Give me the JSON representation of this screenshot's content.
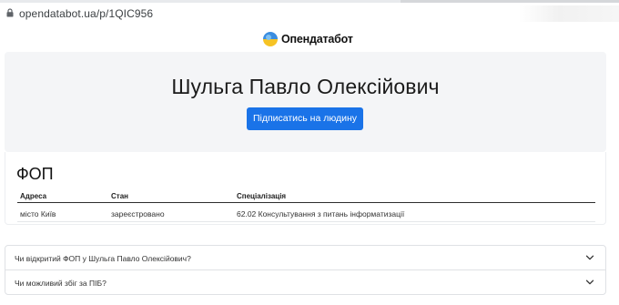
{
  "browser": {
    "url": "opendatabot.ua/p/1QIC956"
  },
  "logo": {
    "name": "Опендатабот"
  },
  "hero": {
    "person_name": "Шульга Павло Олексійович",
    "subscribe_label": "Підписатись на людину"
  },
  "fop": {
    "title": "ФОП",
    "columns": [
      "Адреса",
      "Стан",
      "Спеціалізація"
    ],
    "rows": [
      [
        "місто Київ",
        "зареєстровано",
        "62.02 Консультування з питань інформатизації"
      ]
    ]
  },
  "faq": {
    "items": [
      {
        "question": "Чи відкритий ФОП у Шульга Павло Олексійович?"
      },
      {
        "question": "Чи можливий збіг за ПІБ?"
      }
    ]
  },
  "colors": {
    "accent": "#1a73e8",
    "hero_bg": "#f4f5f7",
    "logo_blue": "#3b8de0",
    "logo_yellow": "#f6c324"
  }
}
